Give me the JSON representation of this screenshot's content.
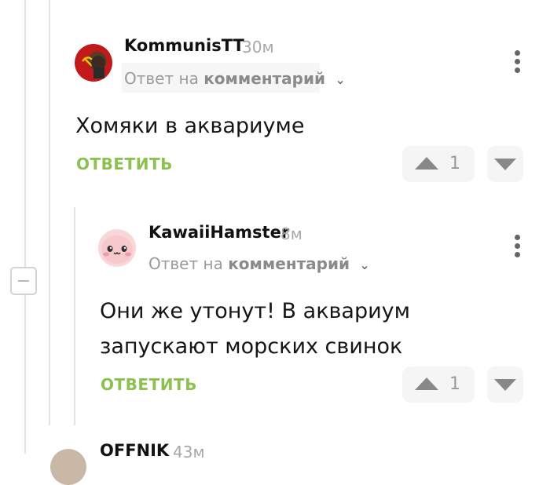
{
  "comments": [
    {
      "author": "KommunisTT",
      "time": "30м",
      "reply_prefix": "Ответ на",
      "reply_target": "комментарий",
      "text": "Хомяки в аквариуме",
      "reply_label": "ОТВЕТИТЬ",
      "votes": "1"
    },
    {
      "author": "KawaiiHamster",
      "time": "8м",
      "reply_prefix": "Ответ на",
      "reply_target": "комментарий",
      "text": "Они же утонут! В аквариум запускают морских свинок",
      "reply_label": "ОТВЕТИТЬ",
      "votes": "1"
    },
    {
      "author": "OFFNIK",
      "time": "43м"
    }
  ],
  "icons": {
    "upvote": "triangle-up",
    "downvote": "triangle-down",
    "more": "vertical-dots",
    "collapse": "minus-square"
  }
}
